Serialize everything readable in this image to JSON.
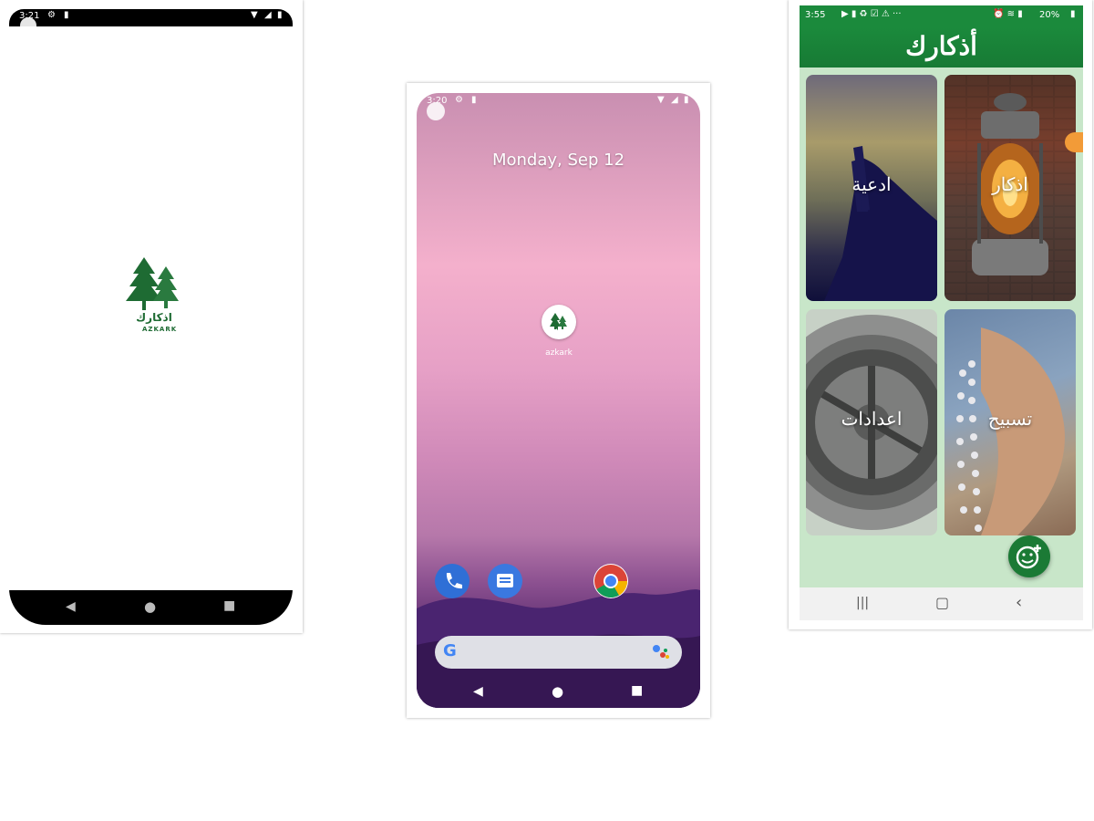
{
  "phone_splash": {
    "status_time": "3:21",
    "logo_arabic": "اذكارك",
    "logo_english": "AZKARK",
    "brand_color": "#1e6b33"
  },
  "phone_home": {
    "status_time": "3:20",
    "date": "Monday, Sep 12",
    "app_label": "azkark",
    "dock_apps": [
      "phone-icon",
      "messages-icon",
      "chrome-icon"
    ],
    "search_icons": [
      "google-icon",
      "assistant-icon"
    ]
  },
  "phone_app": {
    "status_time": "3:55",
    "status_battery": "20%",
    "app_title": "أذكارك",
    "cards": [
      {
        "label": "ادعية"
      },
      {
        "label": "اذكار"
      },
      {
        "label": "اعدادات"
      },
      {
        "label": "تسبيح"
      }
    ],
    "accent_color": "#1b8a3c",
    "background_color": "#c8e6c9"
  }
}
